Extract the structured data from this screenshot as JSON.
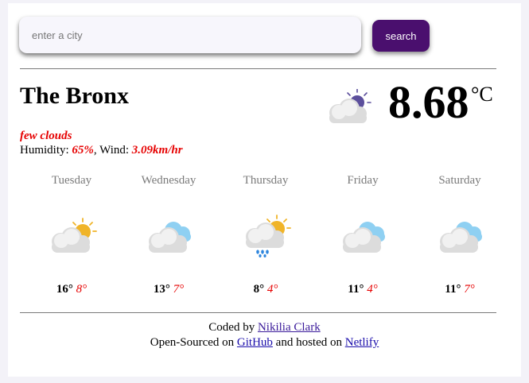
{
  "search": {
    "placeholder": "enter a city",
    "button_label": "search"
  },
  "current": {
    "city": "The Bronx",
    "description": "few clouds",
    "humidity_label": "Humidity: ",
    "humidity_value": "65%",
    "wind_label": ", Wind: ",
    "wind_value": "3.09km/hr",
    "temperature": "8.68",
    "unit": "°C",
    "icon": "few-clouds-night-icon"
  },
  "forecast": [
    {
      "day": "Tuesday",
      "max": "16°",
      "min": "8°",
      "icon": "sun-cloud-icon"
    },
    {
      "day": "Wednesday",
      "max": "13°",
      "min": "7°",
      "icon": "clouds-icon"
    },
    {
      "day": "Thursday",
      "max": "8°",
      "min": "4°",
      "icon": "sun-cloud-rain-icon"
    },
    {
      "day": "Friday",
      "max": "11°",
      "min": "4°",
      "icon": "clouds-icon"
    },
    {
      "day": "Saturday",
      "max": "11°",
      "min": "7°",
      "icon": "clouds-icon"
    }
  ],
  "footer": {
    "coded_by": "Coded by ",
    "author": "Nikilia Clark",
    "open_sourced_on": "Open-Sourced on ",
    "github": "GitHub",
    "hosted_on": " and hosted on ",
    "netlify": "Netlify"
  },
  "colors": {
    "accent": "#4a0f6e",
    "highlight": "#e60000",
    "sun": "#f0b429",
    "moon": "#5c4f9c",
    "cloud": "#e0e0e0",
    "cloud_blue": "#8fd0f2"
  }
}
